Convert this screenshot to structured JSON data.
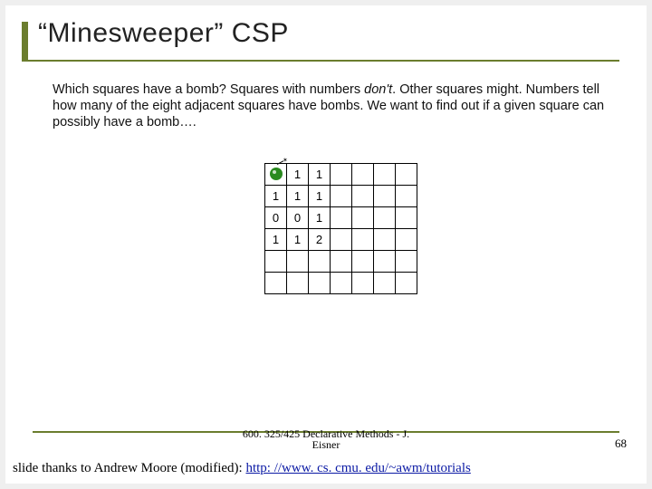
{
  "title": "“Minesweeper” CSP",
  "bodyPrefix": "Which squares have a bomb?  Squares with numbers ",
  "bodyItalic": "don't",
  "bodySuffix": ".  Other squares might.  Numbers tell how many of the eight adjacent squares have bombs.  We want to find out if a given square can possibly have a bomb….",
  "grid": [
    [
      "bomb",
      "1",
      "1",
      "",
      "",
      "",
      ""
    ],
    [
      "1",
      "1",
      "1",
      "",
      "",
      "",
      ""
    ],
    [
      "0",
      "0",
      "1",
      "",
      "",
      "",
      ""
    ],
    [
      "1",
      "1",
      "2",
      "",
      "",
      "",
      ""
    ],
    [
      "",
      "",
      "",
      "",
      "",
      "",
      ""
    ],
    [
      "",
      "",
      "",
      "",
      "",
      "",
      ""
    ]
  ],
  "courseLine1": "600. 325/425 Declarative Methods - J.",
  "courseLine2": "Eisner",
  "pageNumber": "68",
  "creditPrefix": "slide thanks to Andrew Moore (modified): ",
  "creditLinkText": "http: //www. cs. cmu. edu/~awm/tutorials"
}
